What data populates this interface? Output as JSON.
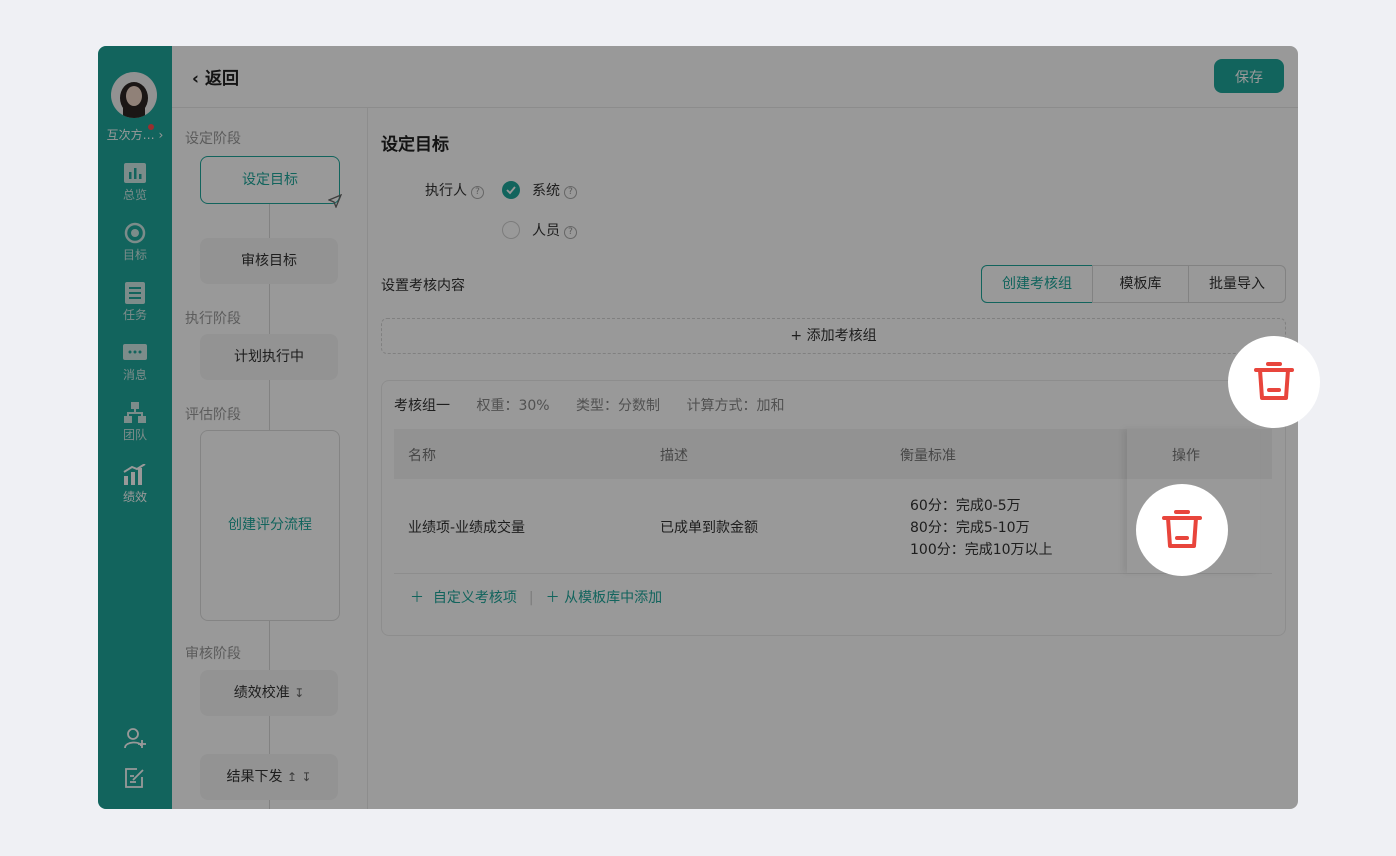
{
  "user": {
    "name": "互次方…"
  },
  "nav": [
    {
      "label": "总览",
      "icon": "chart-icon"
    },
    {
      "label": "目标",
      "icon": "target-icon"
    },
    {
      "label": "任务",
      "icon": "task-list-icon"
    },
    {
      "label": "消息",
      "icon": "message-icon"
    },
    {
      "label": "团队",
      "icon": "team-icon"
    },
    {
      "label": "绩效",
      "icon": "performance-icon",
      "active": true
    }
  ],
  "header": {
    "back_label": "返回",
    "save_label": "保存"
  },
  "flow": {
    "stages": [
      "设定阶段",
      "执行阶段",
      "评估阶段",
      "审核阶段"
    ],
    "steps": {
      "set_goal": "设定目标",
      "review_goal": "审核目标",
      "executing": "计划执行中",
      "create_flow": "创建评分流程",
      "calibration": "绩效校准",
      "publish": "结果下发"
    }
  },
  "main": {
    "title": "设定目标",
    "executor_label": "执行人",
    "options": [
      "系统",
      "人员"
    ],
    "content_label": "设置考核内容",
    "segments": [
      "创建考核组",
      "模板库",
      "批量导入"
    ],
    "add_group": "+ 添加考核组"
  },
  "group": {
    "name": "考核组一",
    "weight": "权重：30%",
    "type": "类型：分数制",
    "calc": "计算方式：加和",
    "columns": [
      "名称",
      "描述",
      "衡量标准",
      "操作"
    ],
    "rows": [
      {
        "name": "业绩项-业绩成交量",
        "desc": "已成单到款金额",
        "criteria": [
          "60分：完成0-5万",
          "80分：完成5-10万",
          "100分：完成10万以上"
        ]
      }
    ],
    "link_custom": "自定义考核项",
    "link_template": "从模板库中添加"
  },
  "colors": {
    "accent": "#1fa79b",
    "danger": "#e8453c"
  }
}
